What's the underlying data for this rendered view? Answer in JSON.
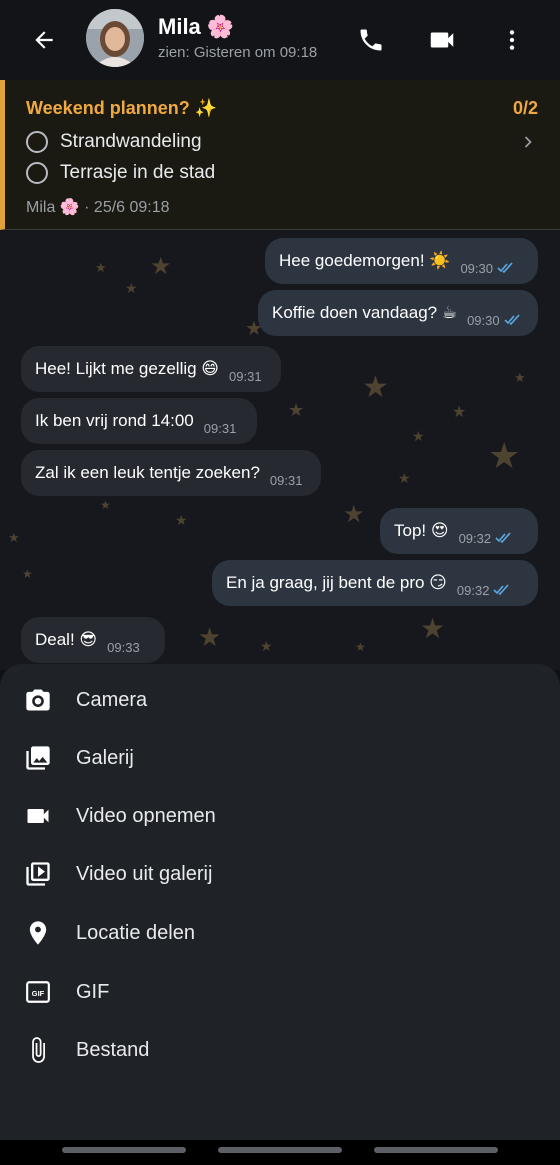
{
  "header": {
    "name": "Mila 🌸",
    "last_seen": "zien: Gisteren om 09:18",
    "icons": [
      "arrow-back-icon",
      "phone-icon",
      "videocam-icon",
      "more-vert-icon"
    ]
  },
  "poll": {
    "title": "Weekend plannen? ✨",
    "count": "0/2",
    "options": [
      {
        "label": "Strandwandeling"
      },
      {
        "label": "Terrasje in de stad"
      }
    ],
    "meta": "Mila 🌸 · 25/6 09:18"
  },
  "messages": [
    {
      "text": "Hee goedemorgen! ☀️",
      "time": "09:30",
      "outgoing": true
    },
    {
      "text": "Koffie doen vandaag? ☕",
      "time": "09:30",
      "outgoing": true
    },
    {
      "text": "Hee! Lijkt me gezellig 😄",
      "time": "09:31",
      "outgoing": false
    },
    {
      "text": "Ik ben vrij rond 14:00",
      "time": "09:31",
      "outgoing": false
    },
    {
      "text": "Zal ik een leuk tentje zoeken?",
      "time": "09:31",
      "outgoing": false
    },
    {
      "text": "Top! 😍",
      "time": "09:32",
      "outgoing": true
    },
    {
      "text": "En ja graag, jij bent de pro 😏",
      "time": "09:32",
      "outgoing": true
    },
    {
      "text": "Deal! 😎",
      "time": "09:33",
      "outgoing": false
    }
  ],
  "attach_menu": {
    "items": [
      {
        "label": "Camera",
        "icon": "camera-icon"
      },
      {
        "label": "Galerij",
        "icon": "gallery-icon"
      },
      {
        "label": "Video opnemen",
        "icon": "videocam-icon"
      },
      {
        "label": "Video uit galerij",
        "icon": "video-library-icon"
      },
      {
        "label": "Locatie delen",
        "icon": "location-pin-icon"
      },
      {
        "label": "GIF",
        "icon": "gif-icon"
      },
      {
        "label": "Bestand",
        "icon": "paperclip-icon"
      }
    ]
  },
  "colors": {
    "poll_accent": "#f0a940",
    "incoming_bubble": "#262a30",
    "outgoing_bubble": "#2d3640",
    "read_ticks": "#5aa9e6"
  }
}
